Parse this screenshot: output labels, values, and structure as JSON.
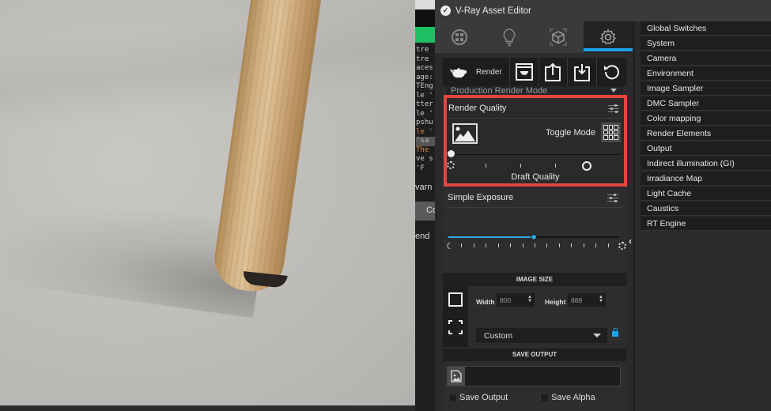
{
  "window": {
    "title": "V-Ray Asset Editor"
  },
  "console": {
    "lines": [
      "tre",
      " tre",
      "aces",
      "age:",
      "TEng",
      "le '",
      "tter",
      "le '",
      "pshu",
      "le '",
      "'sa",
      "The",
      "ve s",
      "'F"
    ],
    "button1": "varn",
    "button2": "Co",
    "button3": "end"
  },
  "tabs": [
    {
      "name": "materials",
      "icon": "materials-icon",
      "active": false
    },
    {
      "name": "lights",
      "icon": "light-bulb-icon",
      "active": false
    },
    {
      "name": "geometry",
      "icon": "cube-icon",
      "active": false
    },
    {
      "name": "settings",
      "icon": "gear-icon",
      "active": true
    }
  ],
  "toolbar": {
    "render_label": "Render",
    "buttons": [
      "render-interactive",
      "export",
      "import",
      "revert"
    ]
  },
  "render_mode": {
    "value": "Production Render Mode"
  },
  "render_quality": {
    "title": "Render Quality",
    "toggle_label": "Toggle Mode",
    "quality_label": "Draft Quality",
    "slider_value": 0,
    "tick_count": 5
  },
  "exposure": {
    "title": "Simple Exposure",
    "slider_fraction": 0.5,
    "tick_count": 15
  },
  "image_size": {
    "header": "IMAGE SIZE",
    "width_label": "Width",
    "width_value": "800",
    "height_label": "Height",
    "height_value": "888",
    "preset": "Custom",
    "aspect_locked": true
  },
  "save_output": {
    "header": "SAVE OUTPUT",
    "path": "",
    "save_output_label": "Save Output",
    "save_output_checked": false,
    "save_alpha_label": "Save Alpha",
    "save_alpha_checked": false
  },
  "settings_list": [
    "Global Switches",
    "System",
    "Camera",
    "Environment",
    "Image Sampler",
    "DMC Sampler",
    "Color mapping",
    "Render Elements",
    "Output",
    "Indirect illumination (GI)",
    "Irradiance Map",
    "Light Cache",
    "Caustics",
    "RT Engine"
  ],
  "colors": {
    "accent": "#1aa3e8",
    "highlight": "#e4463f",
    "console_green": "#1fc064"
  }
}
